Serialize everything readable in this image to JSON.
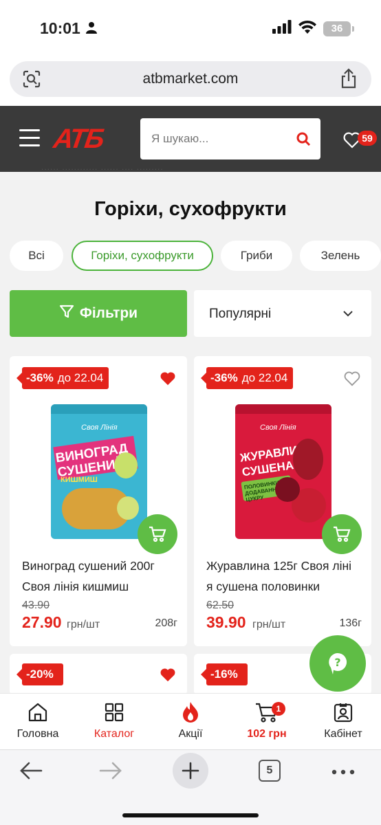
{
  "status": {
    "time": "10:01",
    "battery": "36"
  },
  "browser": {
    "url": "atbmarket.com",
    "tabs_count": "5"
  },
  "header": {
    "logo": "АТБ",
    "search_placeholder": "Я шукаю...",
    "favorites_count": "59"
  },
  "breadcrumbs": "...... ............ ...... .... .........",
  "page": {
    "title": "Горіхи, сухофрукти"
  },
  "categories": [
    {
      "label": "Всі",
      "active": false
    },
    {
      "label": "Горіхи, сухофрукти",
      "active": true
    },
    {
      "label": "Гриби",
      "active": false
    },
    {
      "label": "Зелень",
      "active": false
    }
  ],
  "filters": {
    "button_label": "Фільтри",
    "sort_label": "Популярні"
  },
  "products": [
    {
      "discount": "-36%",
      "until": "до 22.04",
      "favorited": true,
      "package_text": "ВИНОГРАД СУШЕНИЙ",
      "package_brand": "Своя Лінія",
      "package_sub": "КИШМИШ",
      "name_line1": "Виноград сушений 200г",
      "name_line2": "Своя лінія кишмиш",
      "old_price": "43.90",
      "price": "27.90",
      "unit": "грн/шт",
      "weight": "208г",
      "package_color": "#3bb6d2"
    },
    {
      "discount": "-36%",
      "until": "до 22.04",
      "favorited": false,
      "package_text": "ЖУРАВЛИНА СУШЕНА",
      "package_brand": "Своя Лінія",
      "package_sub": "ПОЛОВИНКИ З ДОДАВАННЯМ ЦУКРУ",
      "name_line1": "Журавлина 125г Своя ліні",
      "name_line2": "я сушена половинки",
      "old_price": "62.50",
      "price": "39.90",
      "unit": "грн/шт",
      "weight": "136г",
      "package_color": "#d91a3c"
    },
    {
      "discount": "-20%",
      "favorited": true
    },
    {
      "discount": "-16%",
      "favorited": false
    }
  ],
  "bottom_nav": [
    {
      "label": "Головна",
      "icon": "home-icon"
    },
    {
      "label": "Каталог",
      "icon": "catalog-icon"
    },
    {
      "label": "Акції",
      "icon": "fire-icon"
    },
    {
      "label": "102 грн",
      "icon": "cart-icon",
      "badge": "1"
    },
    {
      "label": "Кабінет",
      "icon": "profile-icon"
    }
  ],
  "colors": {
    "brand_red": "#e3231b",
    "green": "#5fbd45",
    "header_bg": "#3a3a3a"
  }
}
